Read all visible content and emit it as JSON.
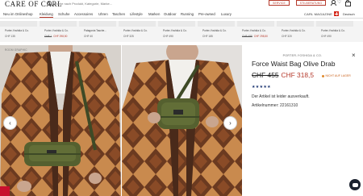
{
  "header": {
    "logo": "CARE OF CARL",
    "search_placeholder": "Suche nach Produkt, Kategorie, Marke...",
    "service_label": "SERVICE",
    "stilberatung_label": "STILBERATUNG",
    "user_label": "Deutsch"
  },
  "nav": {
    "items": [
      "Neu im Onlineshop",
      "Kleidung",
      "Schuhe",
      "Accessoires",
      "Uhren",
      "Taschen",
      "Lifestyle",
      "Marken",
      "Outdoor",
      "Running",
      "Pre-owned",
      "Luxury"
    ],
    "active_index": 1,
    "magazine_label": "CARL MAGAZINE",
    "language": "Deutsch"
  },
  "strip": {
    "items": [
      {
        "name": "Porter-Yoshida & Co.",
        "price": "CHF 135"
      },
      {
        "name": "Porter-Yoshida & Co.",
        "price_old": "CHF 1",
        "price_sale": "CHF 298,50"
      },
      {
        "name": "Patagonia Tasche...",
        "price": "CHF 40"
      },
      {
        "name": "Porter-Yoshida & Co.",
        "price": "CHF 325"
      },
      {
        "name": "Porter-Yoshida & Co.",
        "price": "CHF 490"
      },
      {
        "name": "Porter-Yoshida & Co.",
        "price": "CHF 185"
      },
      {
        "name": "Porter-Yoshida & Co.",
        "price_old": "CHF 455",
        "price_sale": "CHF 298,50"
      },
      {
        "name": "Porter-Yoshida & Co.",
        "price": "CHF 320"
      },
      {
        "name": "Porter-Yoshida & Co.",
        "price": "CHF 490"
      }
    ]
  },
  "gallery": {
    "breadcrumb": "ROOM GRAPHIC",
    "prev_symbol": "‹",
    "next_symbol": "›"
  },
  "product": {
    "brand": "PORTER-YOSHIDA & CO.",
    "title": "Force Waist Bag Olive Drab",
    "price_old": "CHF 455",
    "price_sale": "CHF 318,5",
    "stock_label": "NICHT AUF LAGER",
    "stars": "★★★★★",
    "sold_out": "Der Artikel ist leider ausverkauft.",
    "article_number": "Artikelnummer: 22161310",
    "close_symbol": "×"
  },
  "colors": {
    "accent_red": "#b53a2c",
    "stock_orange": "#c9611a",
    "star_blue": "#1a3370",
    "swiss_red": "#d52b1e"
  }
}
